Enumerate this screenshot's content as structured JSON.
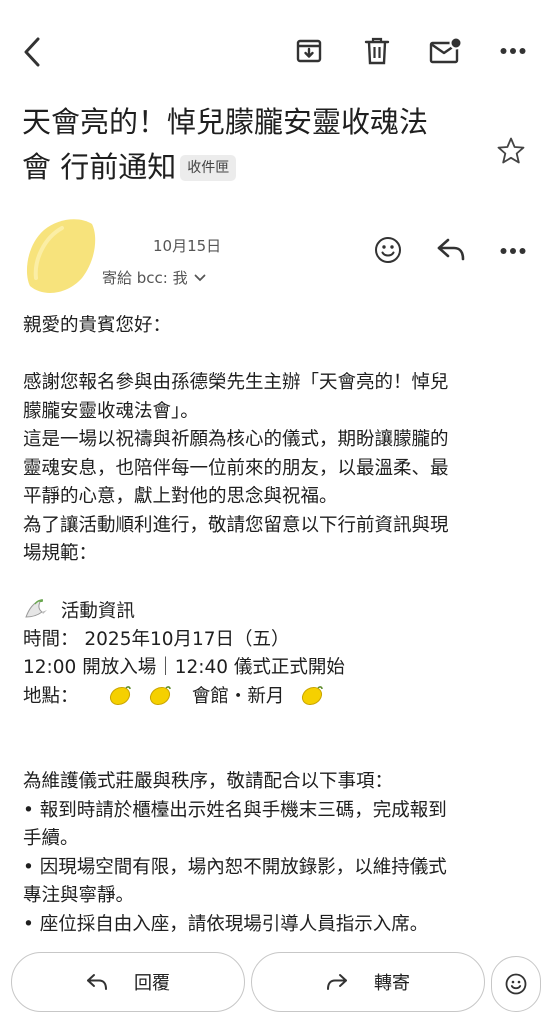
{
  "toolbar": {
    "back_icon": "arrow-back-icon",
    "archive_icon": "archive-icon",
    "delete_icon": "trash-icon",
    "mark_unread_icon": "mail-unread-icon",
    "more_icon": "more-horizontal-icon"
  },
  "message": {
    "subject_line1": "天會亮的！悼兒朦朧安靈收魂法",
    "subject_line2": "會 行前通知",
    "label": "收件匣",
    "date": "10月15日",
    "recipient": "寄給 bcc: 我",
    "body": {
      "greeting": "親愛的貴賓您好：",
      "p1_l1": "感謝您報名參與由孫德榮先生主辦「天會亮的！悼兒",
      "p1_l2": "朦朧安靈收魂法會」。",
      "p2_l1": "這是一場以祝禱與祈願為核心的儀式，期盼讓朦朧的",
      "p2_l2": "靈魂安息，也陪伴每一位前來的朋友，以最溫柔、最",
      "p2_l3": "平靜的心意，獻上對他的思念與祝福。",
      "p3_l1": "為了讓活動順利進行，敬請您留意以下行前資訊與現",
      "p3_l2": "場規範：",
      "info_heading": "活動資訊",
      "time_line": "時間： 2025年10月17日（五）",
      "schedule_line": "12:00 開放入場｜12:40 儀式正式開始",
      "location_label": "地點：",
      "location_name": "會館・新月",
      "rules_intro": "為維護儀式莊嚴與秩序，敬請配合以下事項：",
      "rule1_l1": "• 報到時請於櫃檯出示姓名與手機末三碼，完成報到",
      "rule1_l2": "手續。",
      "rule2_l1": "• 因現場空間有限，場內恕不開放錄影，以維持儀式",
      "rule2_l2": "專注與寧靜。",
      "rule3_l1": "• 座位採自由入座，請依現場引導人員指示入席。"
    }
  },
  "actions": {
    "reply_label": "回覆",
    "forward_label": "轉寄"
  },
  "colors": {
    "text": "#1f1f1f",
    "muted": "#555555",
    "label_bg": "#ececec",
    "lemon": "#f7e04a",
    "border": "#c7c7c7"
  }
}
